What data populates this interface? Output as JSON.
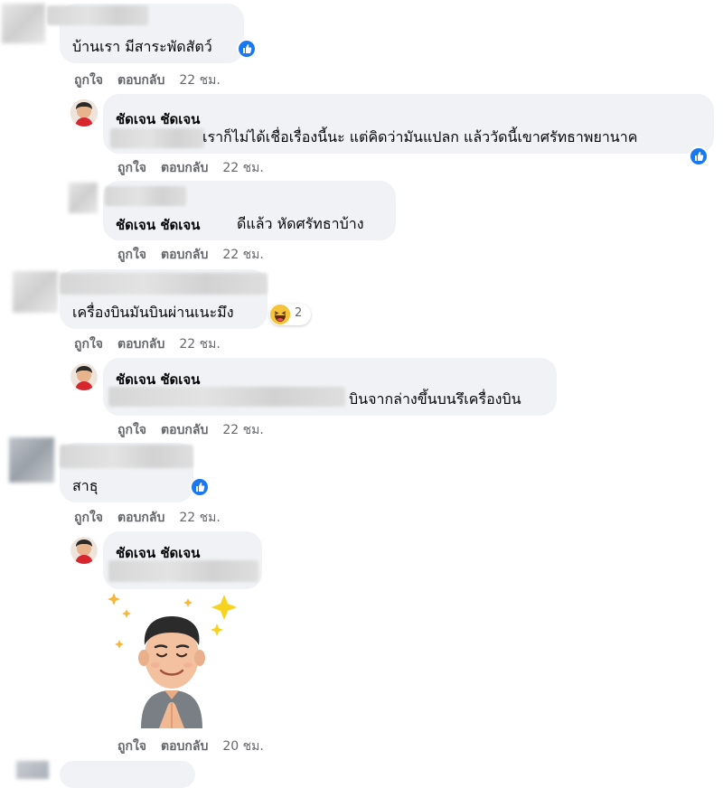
{
  "colors": {
    "bubble": "#f0f2f5",
    "like": "#1877f2",
    "meta": "#65676b",
    "haha": "#f7c33b"
  },
  "labels": {
    "like": "ถูกใจ",
    "reply": "ตอบกลับ"
  },
  "comments": [
    {
      "text": "บ้านเรา มีสาระพัดสัตว์",
      "time": "22 ชม.",
      "reaction": "like-icon"
    },
    {
      "author": "ชัดเจน ชัดเจน",
      "text": "เราก็ไม่ได้เชื่อเรื่องนี้นะ แต่คิดว่ามันแปลก แล้ววัดนี้เขาศรัทธาพยานาค",
      "time": "22 ชม.",
      "reaction": "like-icon"
    },
    {
      "author": "ชัดเจน ชัดเจน",
      "text": "ดีแล้ว หัดศรัทธาบ้าง",
      "time": "22 ชม."
    },
    {
      "text": "เครื่องบินมันบินผ่านเนะมึง",
      "time": "22 ชม.",
      "reaction": "haha-icon",
      "reaction_count": "2"
    },
    {
      "author": "ชัดเจน ชัดเจน",
      "text": "บินจากล่างขึ้นบนรึเครื่องบิน",
      "time": "22 ชม."
    },
    {
      "text": "สาธุ",
      "time": "22 ชม.",
      "reaction": "like-icon"
    },
    {
      "author": "ชัดเจน ชัดเจน",
      "sticker": "praying-avatar-sticker",
      "time": "20 ชม."
    }
  ]
}
